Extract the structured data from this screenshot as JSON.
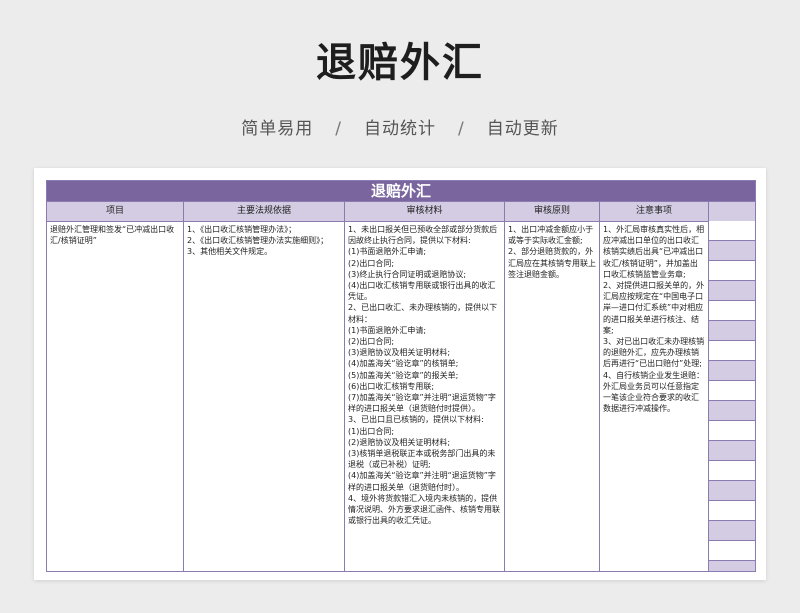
{
  "hero": {
    "title": "退赔外汇",
    "tags": [
      "简单易用",
      "自动统计",
      "自动更新"
    ],
    "separator": "/"
  },
  "sheet": {
    "title": "退赔外汇",
    "headers": [
      "项目",
      "主要法规依据",
      "审核材料",
      "审核原则",
      "注意事项"
    ],
    "cells": {
      "item": "退赔外汇管理和签发“已冲减出口收汇/核销证明”",
      "regulations": "1、《出口收汇核销管理办法》；\n2、《出口收汇核销管理办法实施细则》；                    3、其他相关文件规定。",
      "materials": "1、未出口报关但已预收全部或部分货款后因故终止执行合同，提供以下材料:\n(1)书面退赔外汇申请;\n(2)出口合同;\n(3)终止执行合同证明或退赔协议;\n(4)出口收汇核销专用联或银行出具的收汇凭证。\n2、已出口收汇、未办理核销的，提供以下材料：\n(1)书面退赔外汇申请;\n(2)出口合同;\n(3)退赔协议及相关证明材料;\n(4)加盖海关“验讫章”的核销单;\n(5)加盖海关“验讫章”的报关单;\n(6)出口收汇核销专用联;\n(7)加盖海关“验讫章”并注明“退运货物”字样的进口报关单（退货赔付时提供）。\n3、已出口且已核销的，提供以下材料:\n(1)出口合同;\n(2)退赔协议及相关证明材料;\n(3)核销单退税联正本或税务部门出具的未退税（或已补税）证明;\n(4)加盖海关“验讫章”并注明“退运货物”字样的进口报关单（退货赔付时）。\n4、境外将货款错汇入境内未核销的，提供情况说明、外方要求退汇函件、核销专用联或银行出具的收汇凭证。",
      "principles": "1、出口冲减金额应小于或等于实际收汇金额;\n2、部分退赔货款的，外汇局应在其核销专用联上签注退赔金额。",
      "notes": "1、外汇局审核真实性后，相应冲减出口单位的出口收汇核销实绩后出具“已冲减出口收汇/核销证明”，并加盖出口收汇核销监管业务章;\n2、对提供进口报关单的，外汇局应按规定在“中国电子口岸—进口付汇系统”中对相应的进口报关单进行核注、结案;\n3、对已出口收汇未办理核销的退赔外汇，应先办理核销后再进行“已出口赔付”处理;\n4、自行核销企业发生退赔：外汇局业务员可以任意指定一笔该企业符合要求的收汇数据进行冲减操作。"
    }
  },
  "colors": {
    "banner": "#7a659f",
    "header_fill": "#d3cce3",
    "border": "#8a7bb0"
  }
}
